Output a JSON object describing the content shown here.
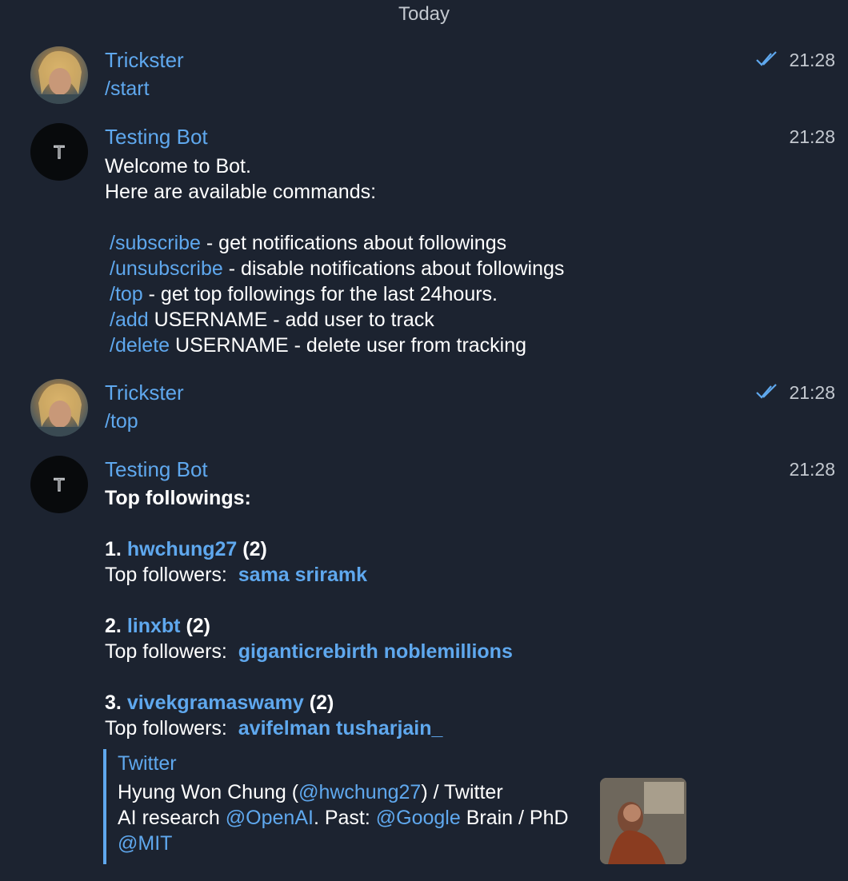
{
  "date_label": "Today",
  "messages": [
    {
      "sender": "Trickster",
      "time": "21:28",
      "text": "/start"
    },
    {
      "sender": "Testing Bot",
      "time": "21:28",
      "lines": [
        "Welcome to Bot.",
        "Here are available commands:"
      ],
      "commands": [
        {
          "cmd": "/subscribe",
          "desc": " - get notifications about followings"
        },
        {
          "cmd": "/unsubscribe",
          "desc": " - disable notifications about followings"
        },
        {
          "cmd": "/top",
          "desc": " - get top followings for the last 24hours."
        },
        {
          "cmd": "/add",
          "desc": " USERNAME - add user to track"
        },
        {
          "cmd": "/delete",
          "desc": " USERNAME - delete user from tracking"
        }
      ]
    },
    {
      "sender": "Trickster",
      "time": "21:28",
      "text": "/top"
    },
    {
      "sender": "Testing Bot",
      "time": "21:28",
      "heading": "Top followings:",
      "entries": [
        {
          "rank": "1.",
          "user": "hwchung27",
          "count": "(2)",
          "followers_label": "Top followers:",
          "followers": "sama sriramk"
        },
        {
          "rank": "2.",
          "user": "linxbt",
          "count": "(2)",
          "followers_label": "Top followers:",
          "followers": "giganticrebirth noblemillions"
        },
        {
          "rank": "3.",
          "user": "vivekgramaswamy",
          "count": "(2)",
          "followers_label": "Top followers:",
          "followers": "avifelman tusharjain_"
        }
      ],
      "preview": {
        "site": "Twitter",
        "title_pre": "Hyung Won Chung (",
        "title_link": "@hwchung27",
        "title_post": ") / Twitter",
        "desc_pre": "AI research ",
        "desc_link1": "@OpenAI",
        "desc_mid": ". Past: ",
        "desc_link2": "@Google",
        "desc_post": " Brain / PhD",
        "desc_link3": "@MIT"
      }
    }
  ],
  "colors": {
    "background": "#1c2330",
    "accent": "#5fa8ee",
    "text": "#ffffff",
    "muted": "#c3c8cf"
  }
}
